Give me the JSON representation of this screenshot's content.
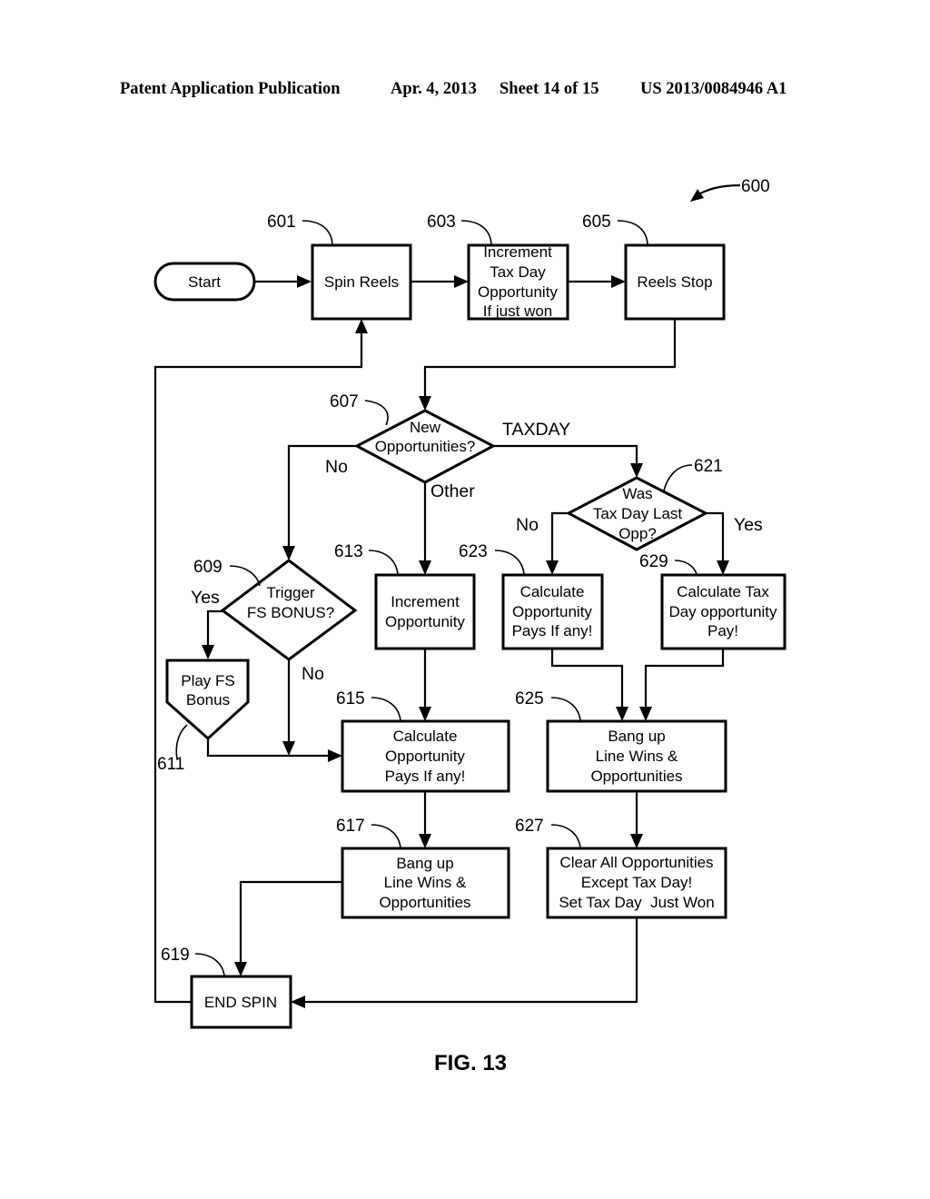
{
  "header": {
    "publication": "Patent Application Publication",
    "date": "Apr. 4, 2013",
    "sheet": "Sheet 14 of 15",
    "number": "US 2013/0084946 A1"
  },
  "figure": {
    "label": "FIG. 13",
    "ref": "600"
  },
  "nodes": {
    "start": {
      "lines": [
        "Start"
      ]
    },
    "n601": {
      "ref": "601",
      "lines": [
        "Spin Reels"
      ]
    },
    "n603": {
      "ref": "603",
      "lines": [
        "Increment",
        "Tax Day",
        "Opportunity",
        "If just won"
      ]
    },
    "n605": {
      "ref": "605",
      "lines": [
        "Reels Stop"
      ]
    },
    "n607": {
      "ref": "607",
      "lines": [
        "New",
        "Opportunities?"
      ]
    },
    "n609": {
      "ref": "609",
      "lines": [
        "Trigger",
        "FS BONUS?"
      ]
    },
    "n611": {
      "ref": "611",
      "lines": [
        "Play FS",
        "Bonus"
      ]
    },
    "n613": {
      "ref": "613",
      "lines": [
        "Increment",
        "Opportunity"
      ]
    },
    "n615": {
      "ref": "615",
      "lines": [
        "Calculate",
        "Opportunity",
        "Pays If any!"
      ]
    },
    "n617": {
      "ref": "617",
      "lines": [
        "Bang up",
        "Line Wins &",
        "Opportunities"
      ]
    },
    "n619": {
      "ref": "619",
      "lines": [
        "END SPIN"
      ]
    },
    "n621": {
      "ref": "621",
      "lines": [
        "Was",
        "Tax Day Last",
        "Opp?"
      ]
    },
    "n623": {
      "ref": "623",
      "lines": [
        "Calculate",
        "Opportunity",
        "Pays If any!"
      ]
    },
    "n625": {
      "ref": "625",
      "lines": [
        "Bang up",
        "Line Wins &",
        "Opportunities"
      ]
    },
    "n627": {
      "ref": "627",
      "lines": [
        "Clear All Opportunities",
        "Except Tax Day!",
        "Set Tax Day  Just Won"
      ]
    },
    "n629": {
      "ref": "629",
      "lines": [
        "Calculate Tax",
        "Day opportunity",
        "Pay!"
      ]
    }
  },
  "branches": {
    "n607_no": "No",
    "n607_other": "Other",
    "n607_taxday": "TAXDAY",
    "n609_yes": "Yes",
    "n609_no": "No",
    "n621_no": "No",
    "n621_yes": "Yes"
  }
}
